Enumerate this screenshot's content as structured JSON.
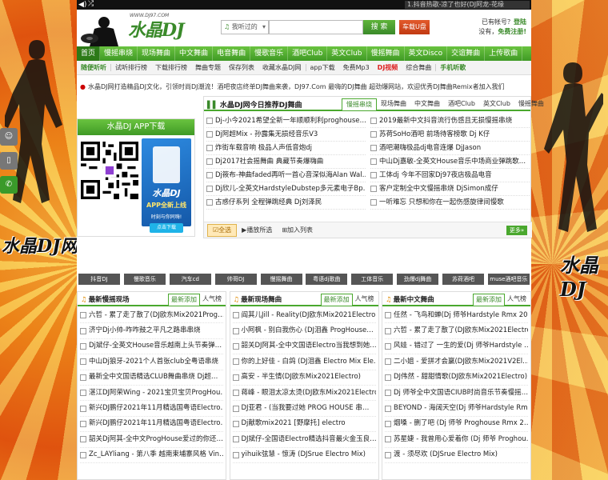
{
  "topbar": {
    "now_playing": "1.抖音热歌-凉了也好(DJ阿龙-花缘"
  },
  "header": {
    "logo_text": "水晶DJ网",
    "logo_url": "WWW.DJ97.COM",
    "search_select": "我听过的",
    "search_button": "搜 索",
    "usb_button": "车载U盘",
    "account_line1_prefix": "已有帐号？",
    "login_link": "登陆",
    "account_line2_prefix": "没有，",
    "register_link": "免费注册!"
  },
  "nav": [
    "首页",
    "慢摇串烧",
    "现场舞曲",
    "中文舞曲",
    "电音舞曲",
    "慢歌音乐",
    "酒吧Club",
    "英文Club",
    "慢摇舞曲",
    "英文Disco",
    "交谊舞曲",
    "上传歌曲"
  ],
  "subnav": [
    {
      "label": "随便听听",
      "style": "hl"
    },
    {
      "label": "试听排行榜",
      "style": ""
    },
    {
      "label": "下载排行榜",
      "style": ""
    },
    {
      "label": "舞曲专题",
      "style": ""
    },
    {
      "label": "保存列表",
      "style": ""
    },
    {
      "label": "收藏水晶DJ网",
      "style": ""
    },
    {
      "label": "app下载",
      "style": ""
    },
    {
      "label": "免费Mp3",
      "style": ""
    },
    {
      "label": "DJ视频",
      "style": "red"
    },
    {
      "label": "综合舞曲",
      "style": ""
    },
    {
      "label": "手机听歌",
      "style": "hl"
    }
  ],
  "notice": "水晶DJ网打造精品DJ文化，引领时尚DJ潮流！酒吧夜店终单DJ舞曲来袭，DJ97.Com 最嗨的DJ舞曲 超劲爆网站，欢迎优秀DJ舞曲Remix者加入我们",
  "app_panel": {
    "title": "水晶DJ APP下载",
    "ad_title": "水晶DJ",
    "ad_sub": "APP全新上线",
    "ad_slogan": "时刻与你同嗨!",
    "ad_button": "点击下载"
  },
  "recommend": {
    "title": "水晶DJ网今日推荐DJ舞曲",
    "tabs": [
      "慢摇串烧",
      "现场舞曲",
      "中文舞曲",
      "酒吧Club",
      "英文Club",
      "慢摇舞曲"
    ],
    "left": [
      "Dj-小今2021希望全新一年顺顺利利proghouse…",
      "Dj阿超Mix - 孙露集无损经音乐V3",
      "炸街车载音响 极品人声低音炮dj",
      "Dj2017社会摇舞曲 典藏节奏爆嗨曲",
      "Dj筱布-神曲faded再听一首心音深似海Alan Wal…",
      "Dj欣儿-全英文HardstyleDubstep多元素电子Bp…",
      "古惑仔系列 全程弹跳经典 Dj刘泽民"
    ],
    "right": [
      "2019最新中文抖音流行伤感且无损慢摇串烧",
      "苏荷SoHo酒吧 前场待客榜歌 Dj K仔",
      "酒吧潮嗨极品dj电音连爆 DjJason",
      "中山Dj嘉敏-全英文House音乐中场商业弹跳歌…",
      "工体dj 今年不回家Dj97夜店极品电音",
      "客户定制全中文慢摇串烧 DjSimon成仔",
      "一听难忘 只想和你在一起伤感旋律间慢歌"
    ],
    "footer_select": "全选",
    "footer_play": "播放所选",
    "footer_add": "加入列表",
    "more": "更多»"
  },
  "tags": [
    "抖音DJ",
    "慢歌音乐",
    "汽车cd",
    "帅哥DJ",
    "慢摇舞曲",
    "粤语dj歌曲",
    "工体音乐",
    "劲爆dj舞曲",
    "苏荷酒吧",
    "muse酒吧音乐"
  ],
  "lists": [
    {
      "title": "最新慢摇现场",
      "tab_new": "最新添加",
      "tab_hot": "人气榜",
      "rows": [
        "六哲 - 累了走了散了(DJ欧东Mix2021Prog…",
        "济宁Dj小帅-咋咋鼓之平凡之路串串烧",
        "Dj斌仔-全英文House音乐越南上头节奏弹…",
        "中山Dj狼牙-2021个人首张club全粤语串烧",
        "最新全中文国语精选CLUB舞曲串烧 Dj超…",
        "湛江DJ阿荣Wing - 2021宝贝宝贝ProgHou…",
        "新兴DJ鹏仔2021年11月精选国粤语Electro…",
        "新兴DJ鹏仔2021年11月精选国粤语Electro…",
        "韶关Dj阿其-全中文ProgHouse爱过的你还…",
        "Zc_LAYliang - 第八季 越南束埔寨风格 Vin…"
      ]
    },
    {
      "title": "最新现场舞曲",
      "tab_new": "最新添加",
      "tab_hot": "人气榜",
      "rows": [
        "阎其儿Jill - Reality(DJ欧东Mix2021Electro)",
        "小阿枫 - 别白我伤心 (DJ泪鑫 ProgHouse…",
        "韶关DJ阿其-全中文国语Electro当我想到她…",
        "你的上好佳 - 白鸽 (DJ泪鑫 Electro Mix Ele…",
        "高安 - 半生情(DJ欧东Mix2021Electro)",
        "蒋峰 - 眼泪太凉太烫(DJ欧东Mix2021Electro)",
        "DJ亚君 - (当我要过她 PROG HOUSE 串…",
        "Dj献歌mix2021 [野摩托] electro",
        "DJ斌仔-全国语Electro精选抖音最火金玉良…",
        "yihuik弦慧 - 惊涛 (DJSrue Electro Mix)"
      ]
    },
    {
      "title": "最新中文舞曲",
      "tab_new": "最新添加",
      "tab_hot": "人气榜",
      "rows": [
        "任然 - 飞鸟和蝉(Dj 师爷Hardstyle Rmx 20…",
        "六哲 - 累了走了散了(DJ欧东Mix2021Electro)",
        "风娃 - 错过了 一生的爱(Dj 师爷Hardstyle …",
        "二小姐 - 爱拼才会赢(DJ欧东Mix2021V2El…",
        "DJ伟然 - 甜甜情歌(DJ欧东Mix2021Electro)",
        "Dj 师爷全中文国语CIUB时尚音乐节奏慢摇…",
        "BEYOND - 海阔天空(Dj 师爷Hardstyle Rm…",
        "烟嗓 - 删了吧 (Dj 师爷 Proghouse Rmx 2…",
        "苏星婕 - 我曾用心爱着你 (Dj 师爷 Proghou…",
        "渡 - 须尽欢 (DJSrue Electro Mix)"
      ]
    }
  ]
}
